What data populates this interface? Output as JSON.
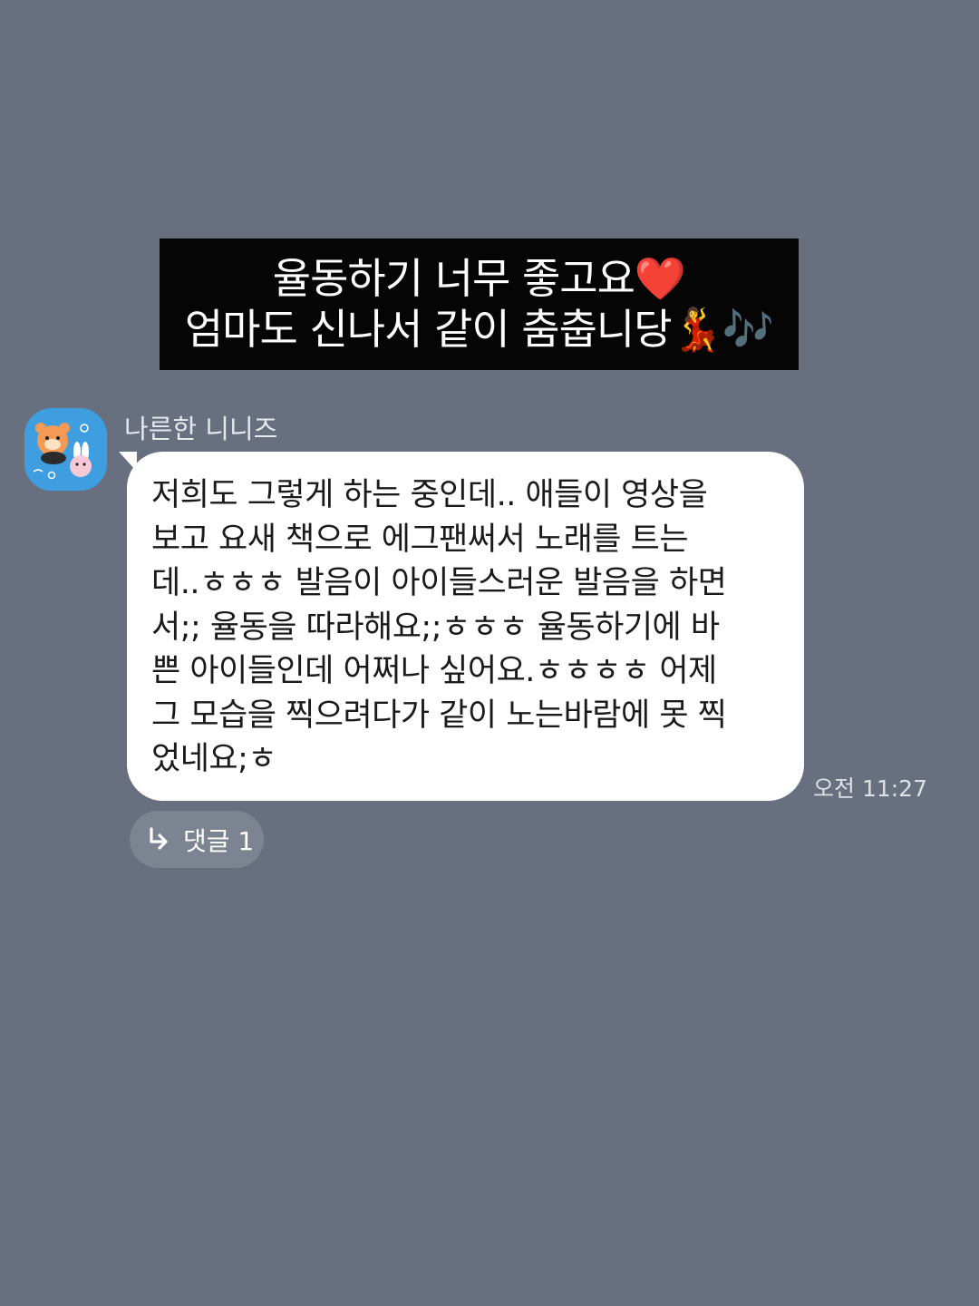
{
  "caption": {
    "line1": "율동하기 너무 좋고요❤️",
    "line2": "엄마도 신나서 같이 춤춥니당💃🎶"
  },
  "message": {
    "sender_name": "나른한 니니즈",
    "avatar_icon": "kakao-friends-sticker-avatar",
    "lines": [
      "저희도 그렇게 하는 중인데.. 애들이 영상을",
      "보고 요새 책으로 에그팬써서 노래를 트는",
      "데..ㅎㅎㅎ 발음이 아이들스러운 발음을 하면",
      "서;; 율동을 따라해요;;ㅎㅎㅎ 율동하기에 바",
      "쁜 아이들인데 어쩌나 싶어요.ㅎㅎㅎㅎ 어제",
      "그 모습을 찍으려다가 같이 노는바람에 못 찍",
      "었네요;ㅎ"
    ],
    "timestamp": "오전 11:27"
  },
  "reply": {
    "icon": "reply-arrow-icon",
    "label": "댓글 1"
  },
  "colors": {
    "background": "#687080",
    "bubble": "#ffffff",
    "caption_bg": "#050505",
    "avatar_bg": "#3f9ee0"
  }
}
